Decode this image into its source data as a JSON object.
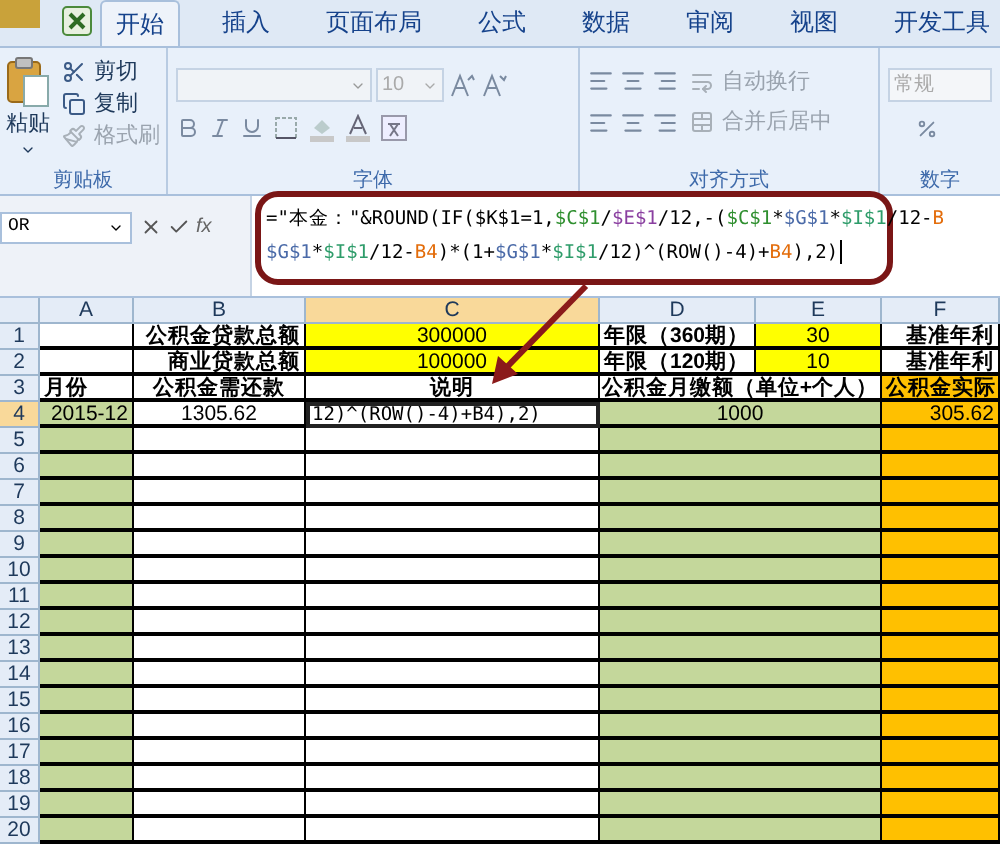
{
  "tabs": [
    {
      "label": "开始",
      "selected": true
    },
    {
      "label": "插入",
      "selected": false
    },
    {
      "label": "页面布局",
      "selected": false
    },
    {
      "label": "公式",
      "selected": false
    },
    {
      "label": "数据",
      "selected": false
    },
    {
      "label": "审阅",
      "selected": false
    },
    {
      "label": "视图",
      "selected": false
    },
    {
      "label": "开发工具",
      "selected": false
    }
  ],
  "ribbon": {
    "clipboard": {
      "label": "剪贴板",
      "paste": "粘贴",
      "items": [
        {
          "kind": "cut",
          "label": "剪切",
          "disabled": false
        },
        {
          "kind": "copy",
          "label": "复制",
          "disabled": false
        },
        {
          "kind": "brush",
          "label": "格式刷",
          "disabled": true
        }
      ]
    },
    "font": {
      "label": "字体",
      "size": "10"
    },
    "alignment": {
      "label": "对齐方式",
      "items": [
        {
          "kind": "wrap",
          "label": "自动换行",
          "disabled": true
        },
        {
          "kind": "merge",
          "label": "合并后居中",
          "disabled": true
        }
      ]
    },
    "number": {
      "label": "数字",
      "format": "常规"
    }
  },
  "formula_bar": {
    "name_box": "OR",
    "function_button": "fx",
    "lines": [
      [
        {
          "text": "=\"本金：\"&ROUND(IF($K$1=1,"
        },
        {
          "text": "$C$1",
          "color": "#2f8f2f"
        },
        {
          "text": "/"
        },
        {
          "text": "$E$1",
          "color": "#8a3fa0"
        },
        {
          "text": "/12,-("
        },
        {
          "text": "$C$1",
          "color": "#2f8f2f"
        },
        {
          "text": "*"
        },
        {
          "text": "$G$1",
          "color": "#4a6aa8"
        },
        {
          "text": "*"
        },
        {
          "text": "$I$1",
          "color": "#2e9c6a"
        },
        {
          "text": "/12-"
        },
        {
          "text": "B",
          "color": "#e36c0a"
        }
      ],
      [
        {
          "text": "$G$1",
          "color": "#4a6aa8"
        },
        {
          "text": "*"
        },
        {
          "text": "$I$1",
          "color": "#2e9c6a"
        },
        {
          "text": "/12-"
        },
        {
          "text": "B4",
          "color": "#e36c0a"
        },
        {
          "text": ")*(1+"
        },
        {
          "text": "$G$1",
          "color": "#4a6aa8"
        },
        {
          "text": "*"
        },
        {
          "text": "$I$1",
          "color": "#2e9c6a"
        },
        {
          "text": "/12)^(ROW()-4)+"
        },
        {
          "text": "B4",
          "color": "#e36c0a"
        },
        {
          "text": "),2)"
        }
      ]
    ]
  },
  "sheet": {
    "columns": [
      {
        "label": "A",
        "selected": false
      },
      {
        "label": "B",
        "selected": false
      },
      {
        "label": "C",
        "selected": true
      },
      {
        "label": "D",
        "selected": false
      },
      {
        "label": "E",
        "selected": false
      },
      {
        "label": "F",
        "selected": false
      }
    ],
    "rows": [
      {
        "number": "1",
        "selected": false,
        "cells": [
          {},
          {
            "text": "公积金贷款总额",
            "bold": true
          },
          {
            "text": "300000",
            "bold": false,
            "color": "#ffff00"
          },
          {
            "text": "年限（360期）",
            "bold": true
          },
          {
            "text": "30",
            "bold": false,
            "color": "#ffff00"
          },
          {
            "text": "基准年利",
            "bold": true
          }
        ]
      },
      {
        "number": "2",
        "selected": false,
        "cells": [
          {},
          {
            "text": "商业贷款总额",
            "bold": true
          },
          {
            "text": "100000",
            "bold": false,
            "color": "#ffff00"
          },
          {
            "text": "年限（120期）",
            "bold": true
          },
          {
            "text": "10",
            "bold": false,
            "color": "#ffff00"
          },
          {
            "text": "基准年利",
            "bold": true
          }
        ]
      },
      {
        "number": "3",
        "selected": false,
        "cells": [
          {
            "text": "月份",
            "bold": true
          },
          {
            "text": "公积金需还款",
            "bold": true
          },
          {
            "text": "说明",
            "bold": true
          },
          {
            "kind": "wide",
            "text": "公积金月缴额（单位+个人）",
            "bold": true
          },
          {
            "text": "公积金实际",
            "bold": true,
            "color": "#ffc000"
          }
        ]
      },
      {
        "number": "4",
        "selected": true,
        "cells": [
          {
            "text": "2015-12",
            "bold": false,
            "color": "#c4d79b"
          },
          {
            "text": "1305.62",
            "bold": false
          },
          {
            "kind": "editing",
            "text": "12)^(ROW()-4)+B4),2)",
            "bold": false
          },
          {
            "kind": "wide",
            "text": "1000",
            "bold": false,
            "color": "#c4d79b"
          },
          {
            "text": "305.62",
            "bold": false,
            "color": "#ffc000"
          }
        ]
      },
      {
        "number": "5",
        "selected": false,
        "cells": [
          {
            "color": "#c4d79b"
          },
          {},
          {},
          {
            "kind": "wide",
            "color": "#c4d79b"
          },
          {
            "color": "#ffc000"
          }
        ]
      },
      {
        "number": "6",
        "selected": false,
        "cells": [
          {
            "color": "#c4d79b"
          },
          {},
          {},
          {
            "kind": "wide",
            "color": "#c4d79b"
          },
          {
            "color": "#ffc000"
          }
        ]
      },
      {
        "number": "7",
        "selected": false,
        "cells": [
          {
            "color": "#c4d79b"
          },
          {},
          {},
          {
            "kind": "wide",
            "color": "#c4d79b"
          },
          {
            "color": "#ffc000"
          }
        ]
      },
      {
        "number": "8",
        "selected": false,
        "cells": [
          {
            "color": "#c4d79b"
          },
          {},
          {},
          {
            "kind": "wide",
            "color": "#c4d79b"
          },
          {
            "color": "#ffc000"
          }
        ]
      },
      {
        "number": "9",
        "selected": false,
        "cells": [
          {
            "color": "#c4d79b"
          },
          {},
          {},
          {
            "kind": "wide",
            "color": "#c4d79b"
          },
          {
            "color": "#ffc000"
          }
        ]
      },
      {
        "number": "10",
        "selected": false,
        "cells": [
          {
            "color": "#c4d79b"
          },
          {},
          {},
          {
            "kind": "wide",
            "color": "#c4d79b"
          },
          {
            "color": "#ffc000"
          }
        ]
      },
      {
        "number": "11",
        "selected": false,
        "cells": [
          {
            "color": "#c4d79b"
          },
          {},
          {},
          {
            "kind": "wide",
            "color": "#c4d79b"
          },
          {
            "color": "#ffc000"
          }
        ]
      },
      {
        "number": "12",
        "selected": false,
        "cells": [
          {
            "color": "#c4d79b"
          },
          {},
          {},
          {
            "kind": "wide",
            "color": "#c4d79b"
          },
          {
            "color": "#ffc000"
          }
        ]
      },
      {
        "number": "13",
        "selected": false,
        "cells": [
          {
            "color": "#c4d79b"
          },
          {},
          {},
          {
            "kind": "wide",
            "color": "#c4d79b"
          },
          {
            "color": "#ffc000"
          }
        ]
      },
      {
        "number": "14",
        "selected": false,
        "cells": [
          {
            "color": "#c4d79b"
          },
          {},
          {},
          {
            "kind": "wide",
            "color": "#c4d79b"
          },
          {
            "color": "#ffc000"
          }
        ]
      },
      {
        "number": "15",
        "selected": false,
        "cells": [
          {
            "color": "#c4d79b"
          },
          {},
          {},
          {
            "kind": "wide",
            "color": "#c4d79b"
          },
          {
            "color": "#ffc000"
          }
        ]
      },
      {
        "number": "16",
        "selected": false,
        "cells": [
          {
            "color": "#c4d79b"
          },
          {},
          {},
          {
            "kind": "wide",
            "color": "#c4d79b"
          },
          {
            "color": "#ffc000"
          }
        ]
      },
      {
        "number": "17",
        "selected": false,
        "cells": [
          {
            "color": "#c4d79b"
          },
          {},
          {},
          {
            "kind": "wide",
            "color": "#c4d79b"
          },
          {
            "color": "#ffc000"
          }
        ]
      },
      {
        "number": "18",
        "selected": false,
        "cells": [
          {
            "color": "#c4d79b"
          },
          {},
          {},
          {
            "kind": "wide",
            "color": "#c4d79b"
          },
          {
            "color": "#ffc000"
          }
        ]
      },
      {
        "number": "19",
        "selected": false,
        "cells": [
          {
            "color": "#c4d79b"
          },
          {},
          {},
          {
            "kind": "wide",
            "color": "#c4d79b"
          },
          {
            "color": "#ffc000"
          }
        ]
      },
      {
        "number": "20",
        "selected": false,
        "cells": [
          {
            "color": "#c4d79b"
          },
          {},
          {},
          {
            "kind": "wide",
            "color": "#c4d79b"
          },
          {
            "color": "#ffc000"
          }
        ]
      }
    ]
  }
}
